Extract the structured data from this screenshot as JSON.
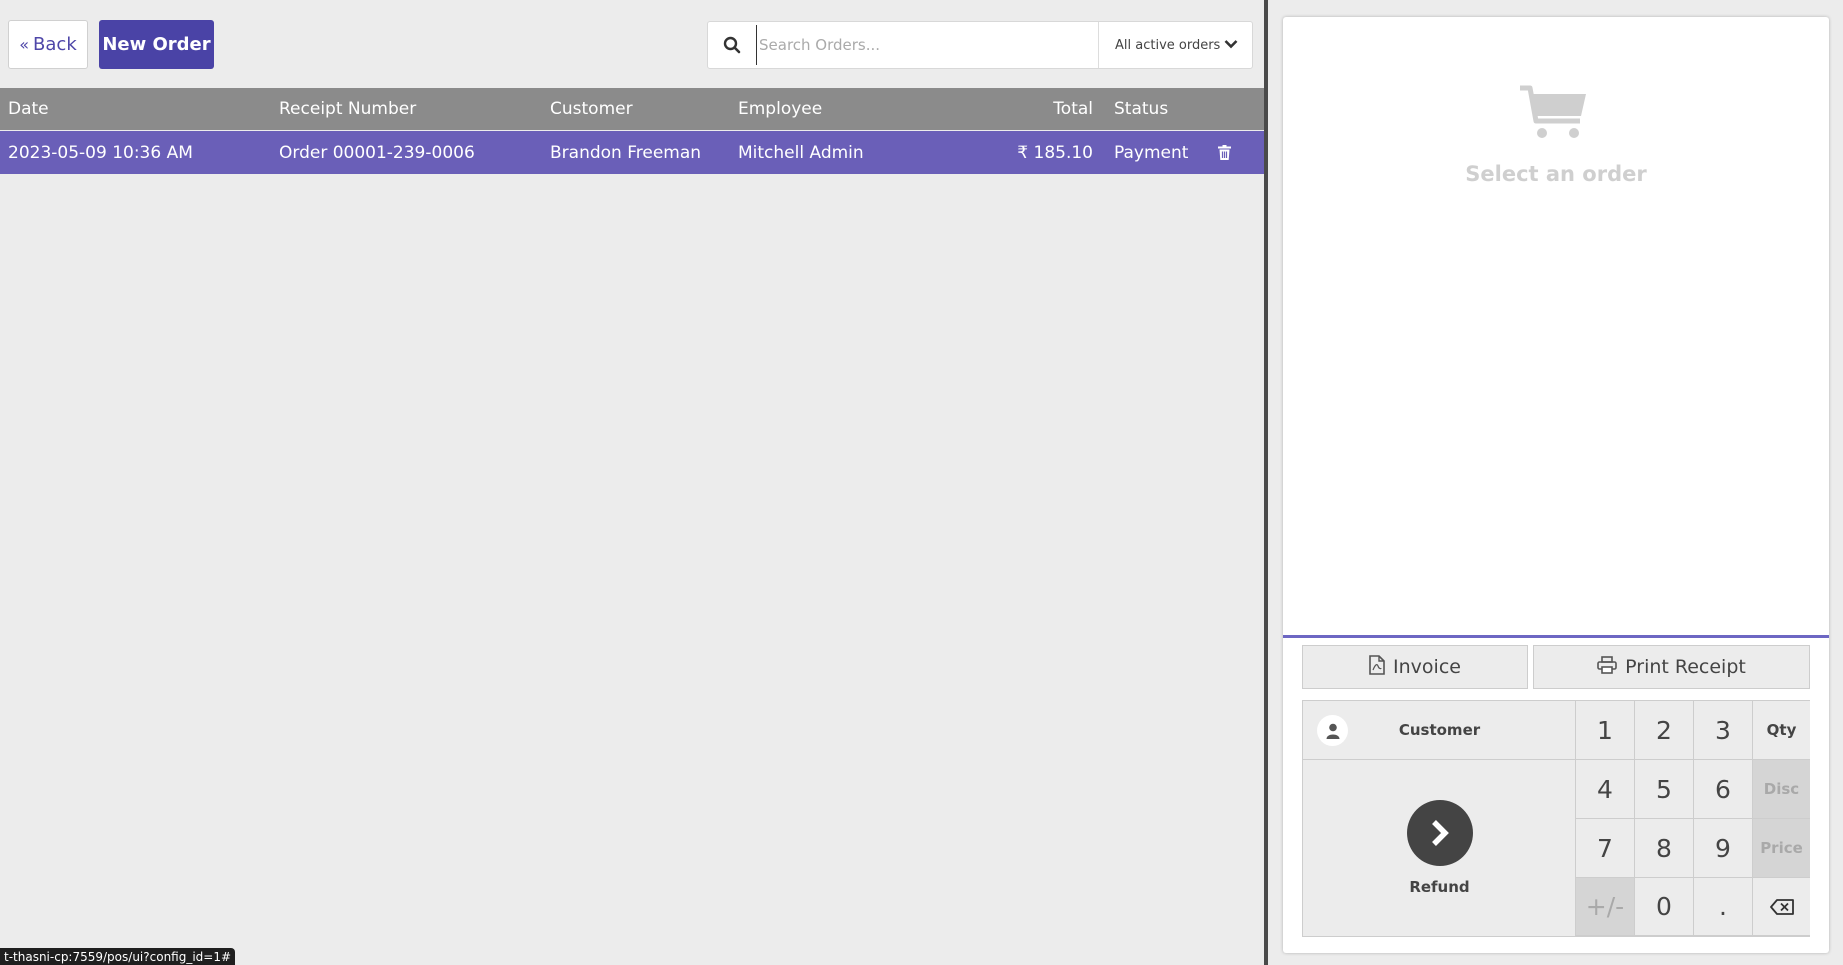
{
  "header": {
    "back_label": "Back",
    "new_order_label": "New Order",
    "search_placeholder": "Search Orders...",
    "filter_value": "All active orders"
  },
  "table": {
    "columns": [
      "Date",
      "Receipt Number",
      "Customer",
      "Employee",
      "Total",
      "Status"
    ],
    "rows": [
      {
        "date": "2023-05-09 10:36 AM",
        "receipt": "Order 00001-239-0006",
        "customer": "Brandon Freeman",
        "employee": "Mitchell Admin",
        "total": "₹ 185.10",
        "status": "Payment"
      }
    ]
  },
  "order_panel": {
    "empty_label": "Select an order",
    "invoice_label": "Invoice",
    "print_label": "Print Receipt",
    "customer_label": "Customer",
    "refund_label": "Refund",
    "keys": {
      "k1": "1",
      "k2": "2",
      "k3": "3",
      "k4": "4",
      "k5": "5",
      "k6": "6",
      "k7": "7",
      "k8": "8",
      "k9": "9",
      "kpm": "+/-",
      "k0": "0",
      "kdot": ".",
      "qty": "Qty",
      "disc": "Disc",
      "price": "Price"
    }
  },
  "status_bar": {
    "url": "t-thasni-cp:7559/pos/ui?config_id=1#"
  },
  "colors": {
    "accent": "#4a43a6",
    "selected_row": "#6a5fb8",
    "header": "#8b8b8b"
  },
  "icons": [
    "chevrons-left-icon",
    "search-icon",
    "chevron-down-icon",
    "trash-icon",
    "cart-icon",
    "file-pdf-icon",
    "printer-icon",
    "user-icon",
    "chevron-right-icon",
    "backspace-icon"
  ]
}
